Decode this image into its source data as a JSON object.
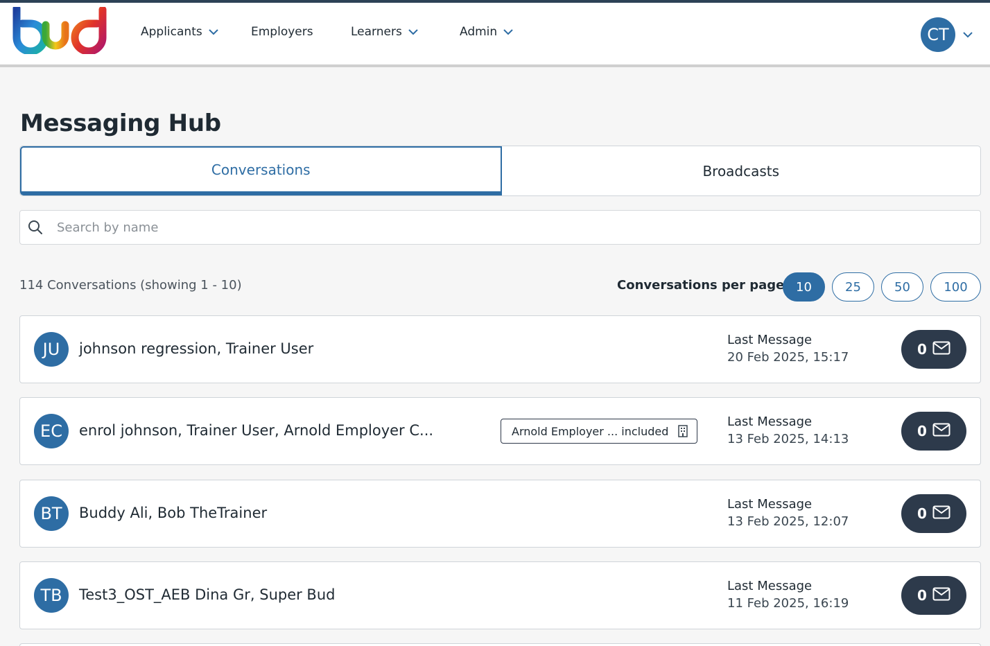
{
  "brand": {
    "logo_text": "bud"
  },
  "nav": {
    "items": [
      {
        "label": "Applicants",
        "has_dropdown": true
      },
      {
        "label": "Employers",
        "has_dropdown": false
      },
      {
        "label": "Learners",
        "has_dropdown": true
      },
      {
        "label": "Admin",
        "has_dropdown": true
      }
    ],
    "user_initials": "CT"
  },
  "page": {
    "title": "Messaging Hub"
  },
  "tabs": [
    {
      "label": "Conversations",
      "active": true
    },
    {
      "label": "Broadcasts",
      "active": false
    }
  ],
  "search": {
    "placeholder": "Search by name",
    "value": ""
  },
  "summary": {
    "count_text": "114 Conversations (showing 1 - 10)",
    "per_page_label": "Conversations per page",
    "per_page_options": [
      "10",
      "25",
      "50",
      "100"
    ],
    "per_page_selected": "10"
  },
  "conversations": [
    {
      "initials": "JU",
      "name": "johnson regression, Trainer User",
      "badge": "",
      "last_label": "Last Message",
      "last_date": "20 Feb 2025, 15:17",
      "unread": "0"
    },
    {
      "initials": "EC",
      "name": "enrol johnson, Trainer User, Arnold Employer C...",
      "badge": "Arnold Employer ... included",
      "last_label": "Last Message",
      "last_date": "13 Feb 2025, 14:13",
      "unread": "0"
    },
    {
      "initials": "BT",
      "name": "Buddy Ali, Bob TheTrainer",
      "badge": "",
      "last_label": "Last Message",
      "last_date": "13 Feb 2025, 12:07",
      "unread": "0"
    },
    {
      "initials": "TB",
      "name": "Test3_OST_AEB Dina Gr, Super Bud",
      "badge": "",
      "last_label": "Last Message",
      "last_date": "11 Feb 2025, 16:19",
      "unread": "0"
    }
  ],
  "colors": {
    "primary": "#2e6da4",
    "dark_button": "#2d3a4b",
    "text": "#1f2a33",
    "background": "#f6f6f6"
  }
}
